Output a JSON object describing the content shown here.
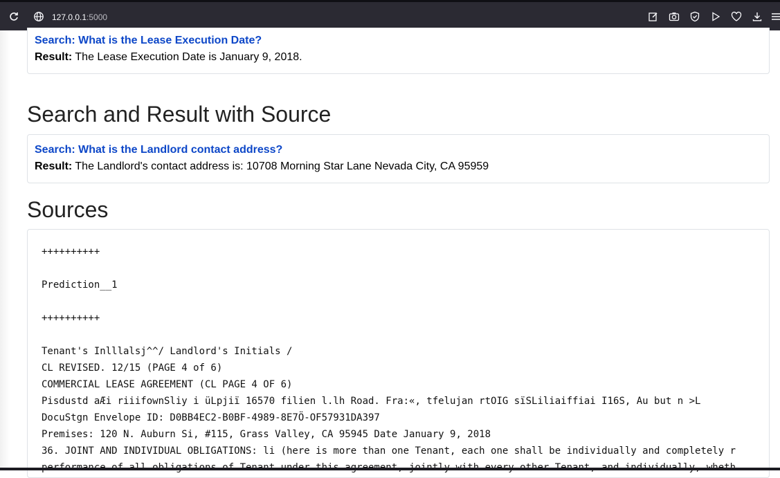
{
  "browser": {
    "url_host": "127.0.0.1",
    "url_port": ":5000"
  },
  "top_card": {
    "search_label": "Search:",
    "search_text": "What is the Lease Execution Date?",
    "result_label": "Result:",
    "result_text": "The Lease Execution Date is January 9, 2018."
  },
  "section1": {
    "title": "Search and Result with Source"
  },
  "mid_card": {
    "search_label": "Search:",
    "search_text": "What is the Landlord contact address?",
    "result_label": "Result:",
    "result_text": "The Landlord's contact address is: 10708 Morning Star Lane Nevada City, CA 95959"
  },
  "section2": {
    "title": "Sources"
  },
  "sources": {
    "lines": [
      "++++++++++",
      "Prediction__1",
      "++++++++++",
      "Tenant's Inlllalsj^^/ Landlord's Initials /",
      "CL REVISED. 12/15 (PAGE 4 of 6)",
      "COMMERCIAL LEASE AGREEMENT (CL PAGE 4 OF 6)",
      "Pisdustd aÆi riiifownSliy i üLpjiï 16570 filien l.lh Road. Fra:«, tfelujan rtOIG sïSLiliaiffiai I16S, Au but n >L",
      "DocuStgn Envelope ID: D0BB4EC2-B0BF-4989-8E7Ö-OF57931DA397",
      "Premises: 120 N. Auburn Si, #115, Grass Valley, CA 95945 Date January 9, 2018",
      "36. JOINT AND INDIVIDUAL OBLIGATIONS: li (here is more than one Tenant, each one shall be individually and completely r",
      "performance of all obligations of Tenant under this agreement, jointly with every other Tenant, and individually, wheth"
    ]
  }
}
